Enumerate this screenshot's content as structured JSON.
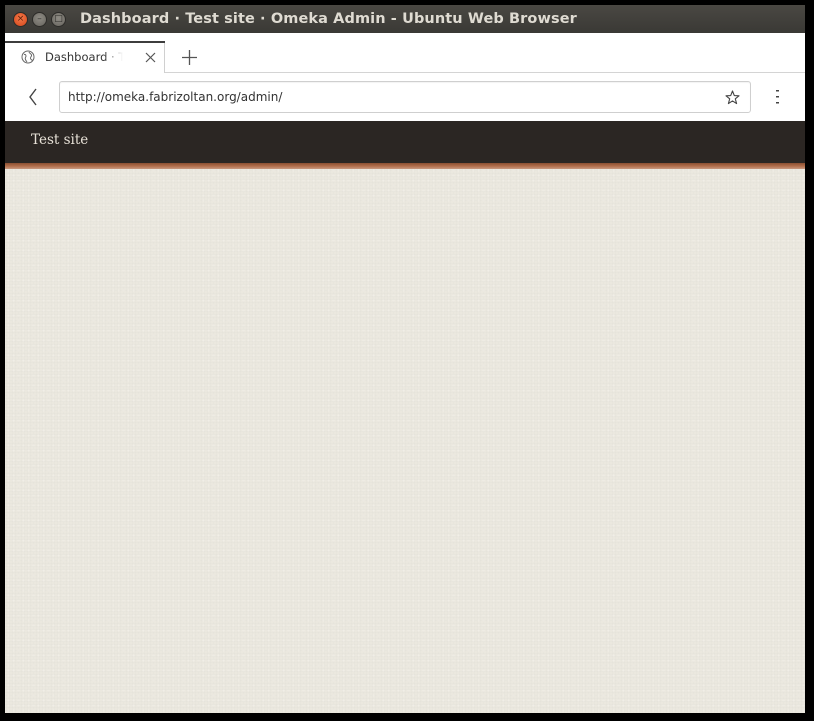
{
  "window": {
    "title": "Dashboard · Test site · Omeka Admin - Ubuntu Web Browser",
    "close_glyph": "×",
    "minimize_glyph": "–",
    "maximize_glyph": "□"
  },
  "tabs": [
    {
      "label": "Dashboard · Test site · Omeka Admin",
      "icon": "globe-icon",
      "active": true
    }
  ],
  "navbar": {
    "url": "http://omeka.fabrizoltan.org/admin/"
  },
  "site": {
    "title": "Test site"
  },
  "colors": {
    "header_bg": "#2b2623",
    "accent_stripe": "#b06d4a",
    "page_bg": "#ebe8df",
    "titlebar_bg": "#3f3e3a"
  }
}
